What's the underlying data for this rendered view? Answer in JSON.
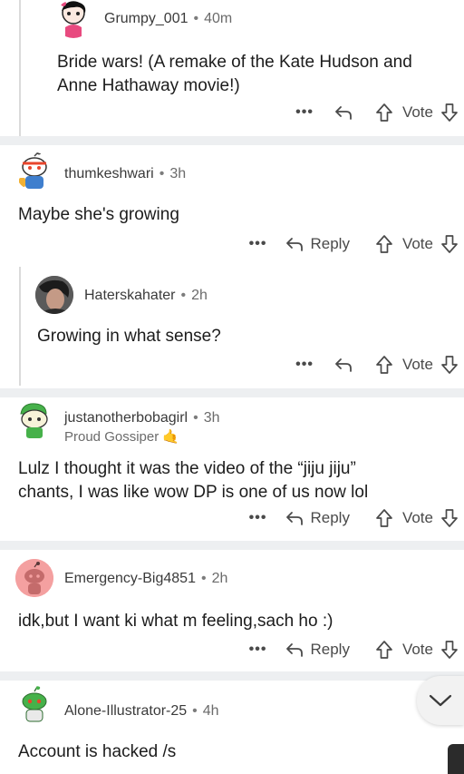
{
  "labels": {
    "reply": "Reply",
    "vote": "Vote",
    "more": "•••"
  },
  "comments": [
    {
      "user": "Grumpy_001",
      "time": "40m",
      "body": "Bride wars! (A remake of the Kate Hudson and Anne Hathaway movie!)",
      "avatar_icon": "snoo-girl-avatar-icon"
    },
    {
      "user": "thumkeshwari",
      "time": "3h",
      "body": "Maybe she's growing",
      "avatar_icon": "snoo-headband-avatar-icon"
    },
    {
      "user": "Haterskahater",
      "time": "2h",
      "body": "Growing in what sense?",
      "avatar_icon": "photo-avatar-icon"
    },
    {
      "user": "justanotherbobagirl",
      "time": "3h",
      "flair": "Proud Gossiper 🤙",
      "body_line1": "Lulz I thought it was the video of the “jiju jiju”",
      "body_line2": "chants, I was like wow DP is one of us now lol",
      "avatar_icon": "snoo-green-cap-avatar-icon"
    },
    {
      "user": "Emergency-Big4851",
      "time": "2h",
      "body": "idk,but I want ki what m feeling,sach ho :)",
      "avatar_icon": "snoo-default-avatar-icon"
    },
    {
      "user": "Alone-Illustrator-25",
      "time": "4h",
      "body": "Account is hacked /s",
      "avatar_icon": "snoo-green-avatar-icon"
    }
  ],
  "colors": {
    "separator": "#edeff1",
    "thread_line": "#dadada",
    "text": "#1c1c1c",
    "meta": "#4a4a4a"
  }
}
